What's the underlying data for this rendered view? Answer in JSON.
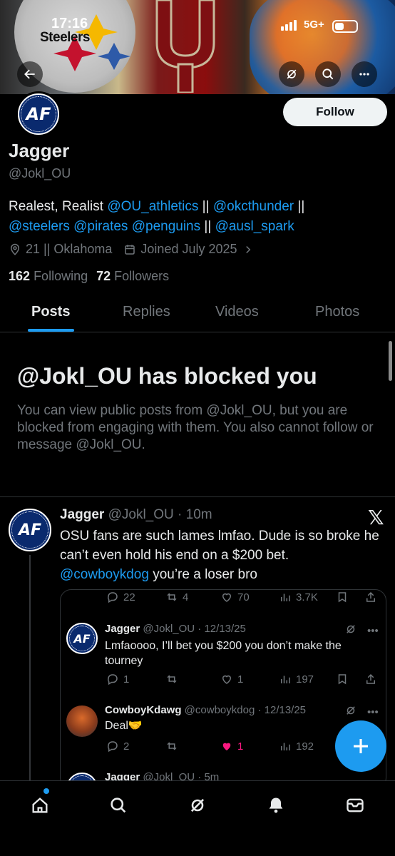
{
  "status_bar": {
    "time": "17:16",
    "network": "5G+"
  },
  "banner": {
    "text": "Steelers"
  },
  "header": {
    "back_icon": "arrow-left-icon",
    "grok_icon": "grok-icon",
    "search_icon": "search-icon",
    "more_icon": "more-icon"
  },
  "profile": {
    "follow_label": "Follow",
    "name": "Jagger",
    "handle": "@Jokl_OU",
    "bio_prefix": "Realest, Realist ",
    "bio_link1": "@OU_athletics",
    "bio_sep1": " || ",
    "bio_link2": "@okcthunder",
    "bio_sep2": " ||",
    "bio_link3": "@steelers",
    "bio_link4": "@pirates",
    "bio_link5": "@penguins",
    "bio_sep3": " || ",
    "bio_link6": "@ausl_spark",
    "location": "21 || Oklahoma",
    "joined": "Joined July 2025",
    "following_count": "162",
    "following_label": "Following",
    "followers_count": "72",
    "followers_label": "Followers"
  },
  "tabs": [
    "Posts",
    "Replies",
    "Videos",
    "Photos"
  ],
  "blocked": {
    "title": "@Jokl_OU has blocked you",
    "text": "You can view public posts from @Jokl_OU, but you are blocked from engaging with them. You also cannot follow or message @Jokl_OU."
  },
  "post": {
    "name": "Jagger",
    "handle": "@Jokl_OU",
    "time": "· 10m",
    "text": "OSU fans are such lames lmfao. Dude is so broke he can’t even hold his end on a $200 bet.",
    "mention": "@cowboykdog",
    "text_tail": " you’re a loser bro",
    "replies": "22",
    "reposts": "4",
    "likes": "70",
    "views": "3.7K"
  },
  "quoted_1": {
    "name": "Jagger",
    "handle": "@Jokl_OU",
    "date": "· 12/13/25",
    "text": "Lmfaoooo, I’ll bet you $200 you don’t make the tourney",
    "replies": "1",
    "likes": "1",
    "views": "197"
  },
  "quoted_2": {
    "name": "CowboyKdawg",
    "handle": "@cowboykdog",
    "date": "· 12/13/25",
    "text": "Deal🤝",
    "replies": "2",
    "likes": "1",
    "views": "192"
  },
  "quoted_3": {
    "name": "Jagger",
    "handle": "@Jokl_OU",
    "date": "· 5m"
  },
  "nav": [
    "home-icon",
    "search-icon",
    "grok-icon",
    "notifications-icon",
    "messages-icon"
  ],
  "colors": {
    "accent": "#1d9bf0",
    "like": "#f91880",
    "muted": "#71767b",
    "text": "#e7e9ea"
  }
}
